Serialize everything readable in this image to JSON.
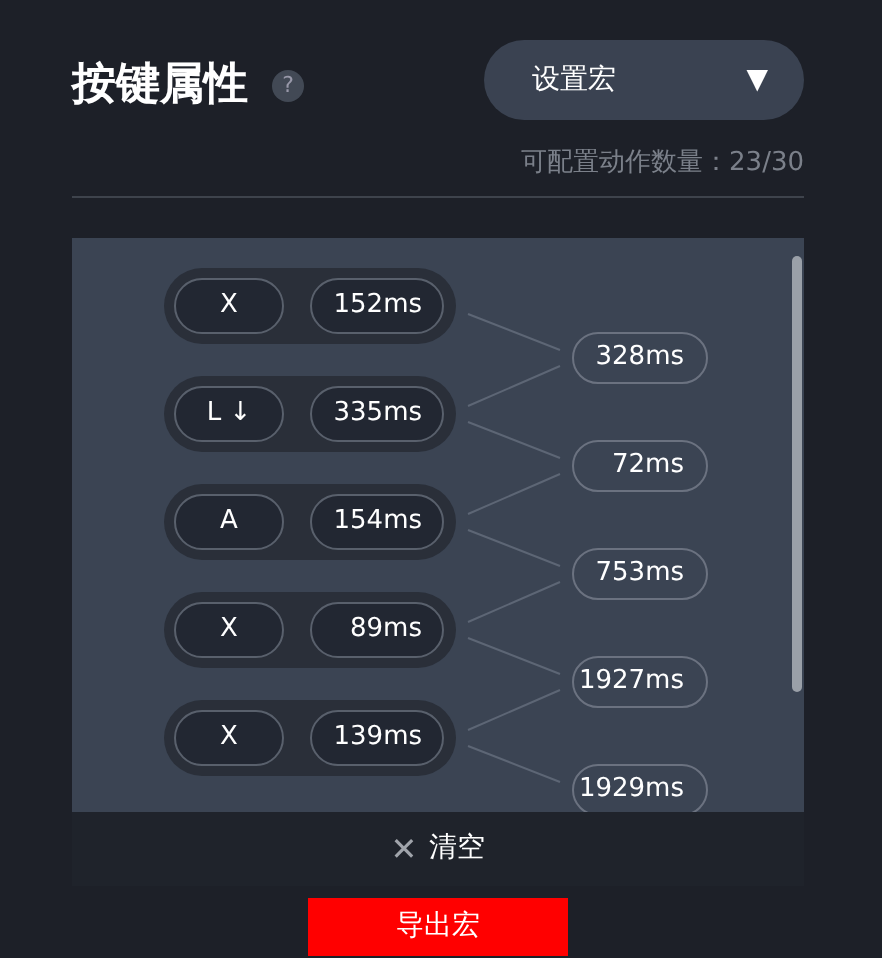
{
  "title": "按键属性",
  "help": "?",
  "dropdown": {
    "value": "设置宏",
    "caret": "▼"
  },
  "action_count": "可配置动作数量：23/30",
  "steps": [
    {
      "key": "X",
      "duration": "152ms"
    },
    {
      "key": "L ↓",
      "duration": "335ms"
    },
    {
      "key": "A",
      "duration": "154ms"
    },
    {
      "key": "X",
      "duration": "89ms"
    },
    {
      "key": "X",
      "duration": "139ms"
    }
  ],
  "delays": [
    "328ms",
    "72ms",
    "753ms",
    "1927ms",
    "1929ms"
  ],
  "clear_button": {
    "icon": "✕",
    "label": "清空"
  },
  "export_button": "导出宏"
}
